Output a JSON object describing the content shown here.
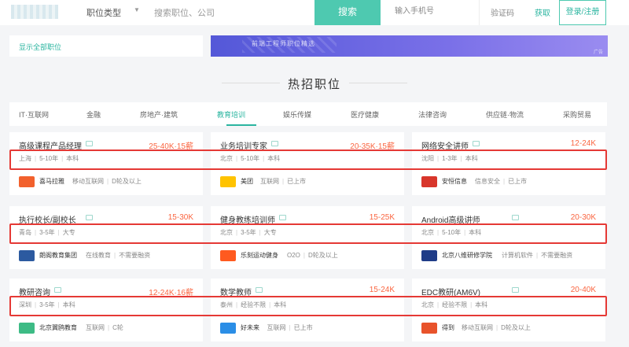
{
  "header": {
    "job_type_label": "职位类型",
    "search_placeholder": "搜索职位、公司",
    "search_button": "搜索",
    "phone_placeholder": "输入手机号",
    "code_placeholder": "验证码",
    "get_code": "获取",
    "login_button": "登录/注册"
  },
  "left_panel": {
    "show_all": "显示全部职位"
  },
  "banner": {
    "text": "前端工程师职位精选",
    "ad_tag": "广告"
  },
  "hot_section": {
    "title": "热招职位"
  },
  "tabs": [
    "IT·互联网",
    "金融",
    "房地产·建筑",
    "教育培训",
    "娱乐传媒",
    "医疗健康",
    "法律咨询",
    "供应链·物流",
    "采购贸易"
  ],
  "active_tab": "教育培训",
  "jobs": [
    {
      "title": "高级课程产品经理",
      "salary": "25-40K·15薪",
      "city": "上海",
      "exp": "5-10年",
      "edu": "本科",
      "company": "喜马拉雅",
      "tag1": "移动互联网",
      "tag2": "D轮及以上",
      "logo_color": "#f2612d"
    },
    {
      "title": "业务培训专家",
      "salary": "20-35K·15薪",
      "city": "北京",
      "exp": "5-10年",
      "edu": "本科",
      "company": "美团",
      "tag1": "互联网",
      "tag2": "已上市",
      "logo_color": "#ffc300"
    },
    {
      "title": "网络安全讲师",
      "salary": "12-24K",
      "city": "沈阳",
      "exp": "1-3年",
      "edu": "本科",
      "company": "安恒信息",
      "tag1": "信息安全",
      "tag2": "已上市",
      "logo_color": "#d8362b"
    },
    {
      "title": "执行校长/副校长",
      "salary": "15-30K",
      "city": "青岛",
      "exp": "3-5年",
      "edu": "大专",
      "company": "朗阁教育集团",
      "tag1": "在线教育",
      "tag2": "不需要融资",
      "logo_color": "#2c5aa0"
    },
    {
      "title": "健身教练培训师",
      "salary": "15-25K",
      "city": "北京",
      "exp": "3-5年",
      "edu": "大专",
      "company": "乐刻运动健身",
      "tag1": "O2O",
      "tag2": "D轮及以上",
      "logo_color": "#ff5a1f"
    },
    {
      "title": "Android高级讲师",
      "salary": "20-30K",
      "city": "北京",
      "exp": "5-10年",
      "edu": "本科",
      "company": "北京八维研修学院",
      "tag1": "计算机软件",
      "tag2": "不需要融资",
      "logo_color": "#1f3c88"
    },
    {
      "title": "教研咨询",
      "salary": "12-24K·16薪",
      "city": "深圳",
      "exp": "3-5年",
      "edu": "本科",
      "company": "北京翼鸥教育",
      "tag1": "互联网",
      "tag2": "C轮",
      "logo_color": "#3dbb85"
    },
    {
      "title": "数学教师",
      "salary": "15-24K",
      "city": "泰州",
      "exp": "经验不限",
      "edu": "本科",
      "company": "好未来",
      "tag1": "互联网",
      "tag2": "已上市",
      "logo_color": "#2b8ee6"
    },
    {
      "title": "EDC教研(AM6V)",
      "salary": "20-40K",
      "city": "北京",
      "exp": "经验不限",
      "edu": "本科",
      "company": "得到",
      "tag1": "移动互联网",
      "tag2": "D轮及以上",
      "logo_color": "#e8532b"
    }
  ]
}
